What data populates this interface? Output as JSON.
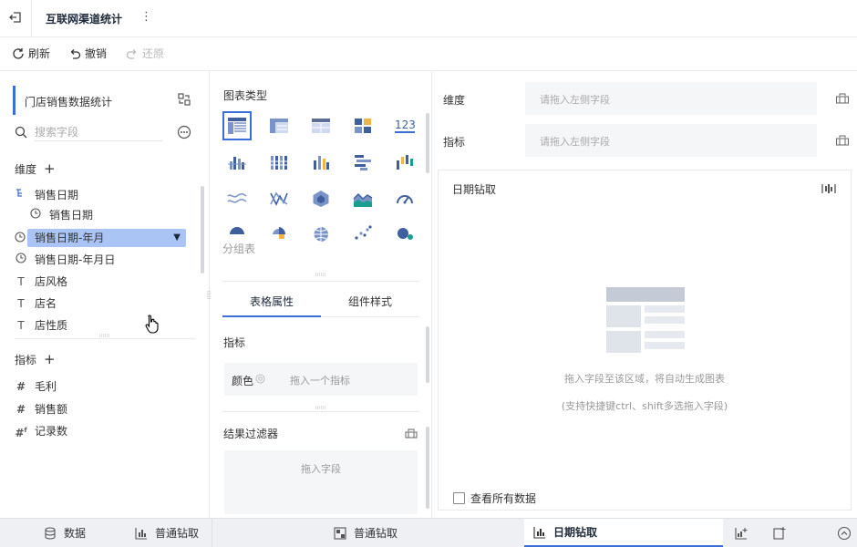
{
  "header": {
    "title": "互联网渠道统计",
    "more": "⋮"
  },
  "toolbar": {
    "refresh": "刷新",
    "undo": "撤销",
    "redo": "还原"
  },
  "left": {
    "dataset": "门店销售数据统计",
    "search_placeholder": "搜索字段",
    "dimension_label": "维度",
    "dimensions": [
      {
        "label": "销售日期",
        "icon": "hierarchy-icon"
      },
      {
        "label": "销售日期",
        "icon": "clock-icon"
      },
      {
        "label": "销售日期-年月",
        "icon": "clock-icon"
      },
      {
        "label": "销售日期-年月日",
        "icon": "clock-icon"
      },
      {
        "label": "店风格",
        "icon": "text-icon"
      },
      {
        "label": "店名",
        "icon": "text-icon"
      },
      {
        "label": "店性质",
        "icon": "text-icon"
      }
    ],
    "indicator_label": "指标",
    "indicators": [
      {
        "label": "毛利",
        "icon": "hash-icon"
      },
      {
        "label": "销售额",
        "icon": "hash-icon"
      },
      {
        "label": "记录数",
        "icon": "calc-hash-icon"
      }
    ]
  },
  "middle": {
    "chart_types_title": "图表类型",
    "chart_types_current": "分组表",
    "tabs": [
      "表格属性",
      "组件样式"
    ],
    "indicator_label": "指标",
    "color_label": "颜色",
    "color_drop": "拖入一个指标",
    "filter_label": "结果过滤器",
    "filter_drop": "拖入字段"
  },
  "right": {
    "dimension_label": "维度",
    "dimension_drop": "请拖入左侧字段",
    "indicator_label": "指标",
    "indicator_drop": "请拖入左侧字段",
    "canvas_title": "日期钻取",
    "hint1": "拖入字段至该区域，将自动生成图表",
    "hint2": "(支持快捷键ctrl、shift多选拖入字段)",
    "view_all": "查看所有数据"
  },
  "bottom": {
    "tabs": [
      {
        "label": "数据",
        "icon": "database-icon"
      },
      {
        "label": "普通钻取",
        "icon": "chart-icon"
      },
      {
        "label": "普通钻取",
        "icon": "dashboard-icon"
      },
      {
        "label": "日期钻取",
        "icon": "chart-icon"
      }
    ]
  },
  "colors": {
    "accent": "#3b6ed7",
    "selected": "#a9c4f5",
    "indicator": "#1a9e8f"
  }
}
